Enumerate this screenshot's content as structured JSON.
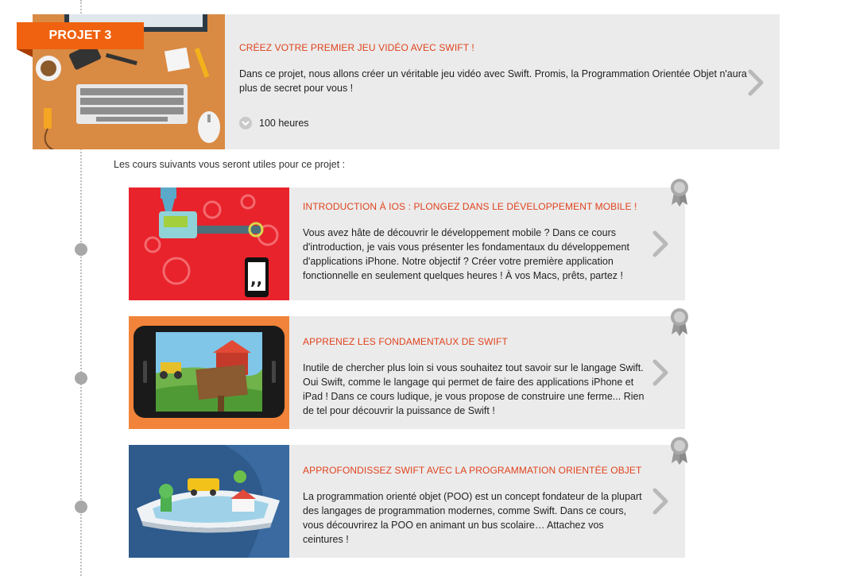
{
  "project": {
    "tag": "PROJET 3",
    "title": "CRÉEZ VOTRE PREMIER JEU VIDÉO AVEC SWIFT !",
    "description": "Dans ce projet, nous allons créer un véritable jeu vidéo avec Swift. Promis, la Programmation Orientée Objet n'aura plus de secret pour vous !",
    "duration": "100 heures"
  },
  "intro_text": "Les cours suivants vous seront utiles pour ce projet :",
  "courses": [
    {
      "title": "INTRODUCTION À IOS : PLONGEZ DANS LE DÉVELOPPEMENT MOBILE !",
      "description": "Vous avez hâte de découvrir le développement mobile ? Dans ce cours d'introduction, je vais vous présenter les fondamentaux du développement d'applications iPhone. Notre objectif ? Créer votre première application fonctionnelle en seulement quelques heures ! À vos Macs, prêts, partez !"
    },
    {
      "title": "APPRENEZ LES FONDAMENTAUX DE SWIFT",
      "description": "Inutile de chercher plus loin si vous souhaitez tout savoir sur le langage Swift. Oui Swift, comme le langage qui permet de faire des applications iPhone et iPad ! Dans ce cours ludique, je vous propose de construire une ferme... Rien de tel pour découvrir la puissance de Swift !"
    },
    {
      "title": "APPROFONDISSEZ SWIFT AVEC LA PROGRAMMATION ORIENTÉE OBJET",
      "description": "La programmation orienté objet (POO) est un concept fondateur de la plupart des langages de programmation modernes, comme Swift. Dans ce cours, vous découvrirez la POO en animant un bus scolaire… Attachez vos ceintures !"
    }
  ],
  "icons": {
    "chevron": "chevron-right-icon",
    "badge": "award-ribbon-icon",
    "duration": "chevron-down-icon"
  },
  "colors": {
    "accent": "#e0431e",
    "tag": "#f0620f",
    "card_bg": "#ebebeb",
    "timeline_dot": "#a8a8a8"
  }
}
